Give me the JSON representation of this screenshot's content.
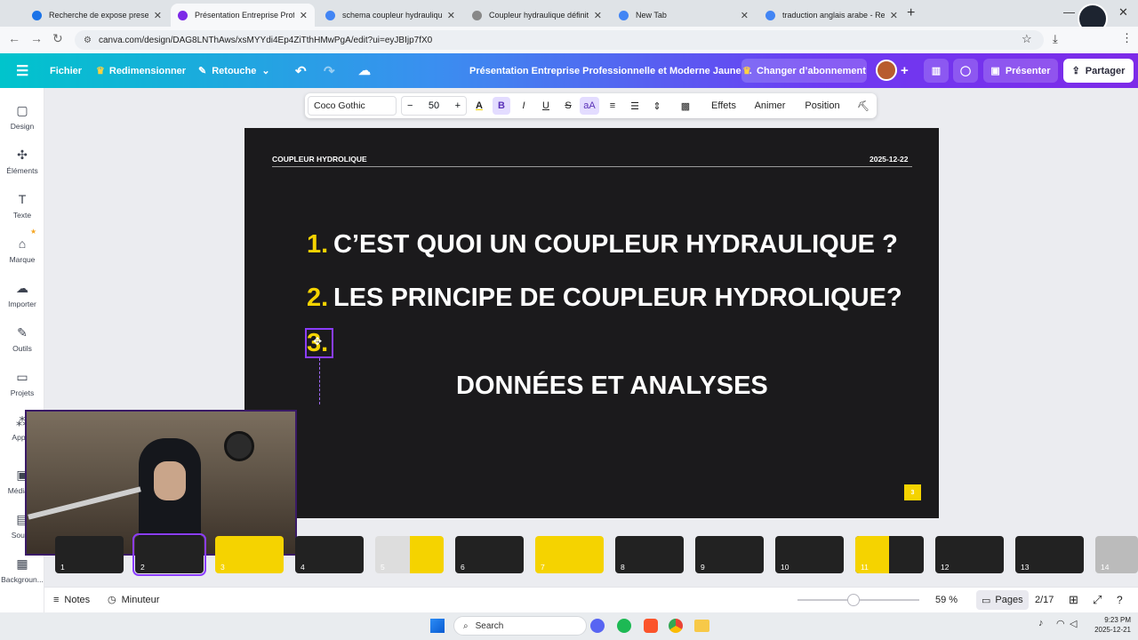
{
  "browser": {
    "tabs": [
      {
        "label": "Recherche de expose presentati",
        "color": "#1a73e8"
      },
      {
        "label": "Présentation Entreprise Profess",
        "color": "#7d2ae8"
      },
      {
        "label": "schema coupleur hydraulique -",
        "color": "#4285f4"
      },
      {
        "label": "Coupleur hydraulique définitio",
        "color": "#888888"
      },
      {
        "label": "New Tab",
        "color": "#4285f4"
      },
      {
        "label": "traduction anglais arabe - Rech",
        "color": "#4285f4"
      }
    ],
    "url": "canva.com/design/DAG8LNThAws/xsMYYdi4Ep4ZiTthHMwPgA/edit?ui=eyJBIjp7fX0"
  },
  "canva_bar": {
    "file": "Fichier",
    "resize": "Redimensionner",
    "retouch": "Retouche",
    "doc_title": "Présentation Entreprise Professionnelle et Moderne Jaune ...",
    "upgrade": "Changer d’abonnement",
    "present": "Présenter",
    "share": "Partager"
  },
  "sidebar": [
    {
      "label": "Design",
      "icon": "layout-icon"
    },
    {
      "label": "Éléments",
      "icon": "elements-icon"
    },
    {
      "label": "Texte",
      "icon": "text-icon"
    },
    {
      "label": "Marque",
      "icon": "brand-icon"
    },
    {
      "label": "Importer",
      "icon": "upload-icon"
    },
    {
      "label": "Outils",
      "icon": "tools-icon"
    },
    {
      "label": "Projets",
      "icon": "folder-icon"
    },
    {
      "label": "Applis",
      "icon": "apps-icon"
    },
    {
      "label": "Média m",
      "icon": "media-icon"
    },
    {
      "label": "Sous-t",
      "icon": "subtitles-icon"
    },
    {
      "label": "Backgroun...",
      "icon": "background-icon"
    }
  ],
  "text_toolbar": {
    "font": "Coco Gothic",
    "size": "50",
    "effects": "Effets",
    "animate": "Animer",
    "position": "Position"
  },
  "slide": {
    "header_left": "COUPLEUR HYDROLIQUE",
    "header_right": "2025-12-22",
    "items": [
      {
        "num": "1.",
        "text": "C’EST QUOI UN COUPLEUR HYDRAULIQUE ?"
      },
      {
        "num": "2.",
        "text": "LES PRINCIPE DE COUPLEUR HYDROLIQUE?"
      },
      {
        "num": "3.",
        "text": ""
      }
    ],
    "subtitle": "DONNÉES ET ANALYSES",
    "page_badge": "3"
  },
  "thumbnails": [
    "1",
    "2",
    "3",
    "4",
    "5",
    "6",
    "7",
    "8",
    "9",
    "10",
    "11",
    "12",
    "13",
    "14"
  ],
  "bottom_bar": {
    "notes": "Notes",
    "timer": "Minuteur",
    "zoom": "59 %",
    "pages": "Pages",
    "page_count": "2/17"
  },
  "taskbar": {
    "search": "Search",
    "time": "9:23 PM",
    "date": "2025-12-21"
  }
}
